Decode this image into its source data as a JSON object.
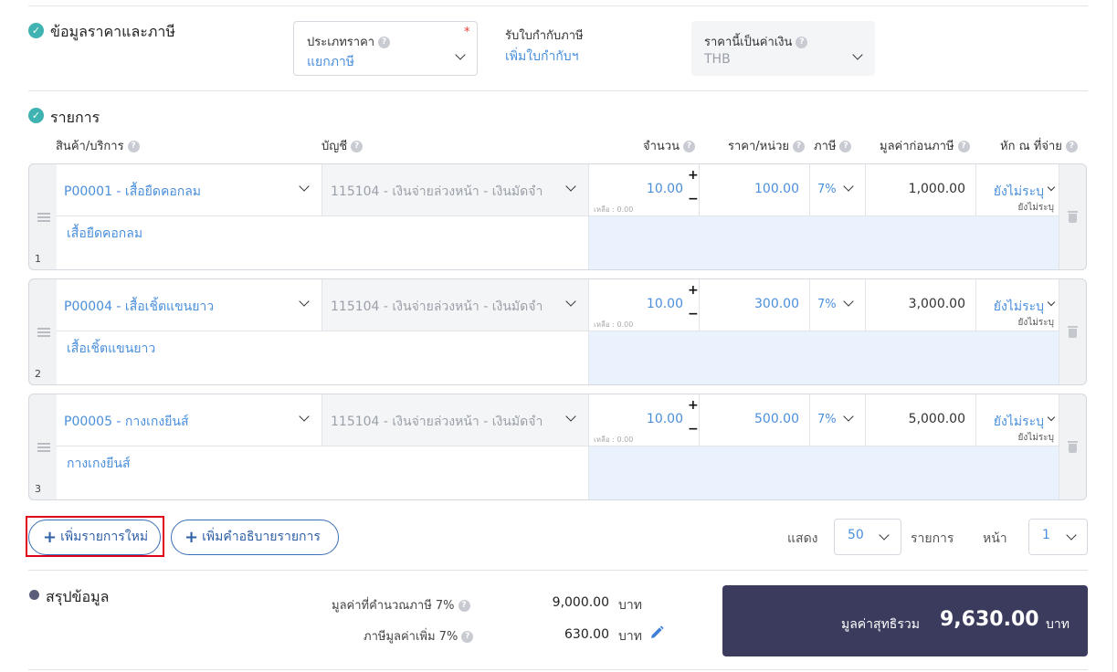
{
  "price_tax": {
    "title": "ข้อมูลราคาและภาษี",
    "price_type_label": "ประเภทราคา",
    "price_type_value": "แยกภาษี",
    "tax_invoice_label": "รับใบกำกับภาษี",
    "tax_invoice_link": "เพิ่มใบกำกับฯ",
    "currency_label": "ราคานี้เป็นค่าเงิน",
    "currency_value": "THB"
  },
  "items": {
    "title": "รายการ",
    "headers": {
      "product": "สินค้า/บริการ",
      "account": "บัญชี",
      "quantity": "จำนวน",
      "unit_price": "ราคา/หน่วย",
      "tax": "ภาษี",
      "pretax": "มูลค่าก่อนภาษี",
      "withholding": "หัก ณ ที่จ่าย"
    },
    "rows": [
      {
        "index": "1",
        "product": "P00001 - เสื้อยืดคอกลม",
        "account": "115104 - เงินจ่ายล่วงหน้า - เงินมัดจำ",
        "quantity": "10.00",
        "remaining": "เหลือ : 0.00",
        "price": "100.00",
        "tax": "7%",
        "pretax": "1,000.00",
        "withholding": "ยังไม่ระบุ",
        "withholding_sub": "ยังไม่ระบุ",
        "description": "เสื้อยืดคอกลม"
      },
      {
        "index": "2",
        "product": "P00004 - เสื้อเชิ้ตแขนยาว",
        "account": "115104 - เงินจ่ายล่วงหน้า - เงินมัดจำ",
        "quantity": "10.00",
        "remaining": "เหลือ : 0.00",
        "price": "300.00",
        "tax": "7%",
        "pretax": "3,000.00",
        "withholding": "ยังไม่ระบุ",
        "withholding_sub": "ยังไม่ระบุ",
        "description": "เสื้อเชิ้ตแขนยาว"
      },
      {
        "index": "3",
        "product": "P00005 - กางเกงยีนส์",
        "account": "115104 - เงินจ่ายล่วงหน้า - เงินมัดจำ",
        "quantity": "10.00",
        "remaining": "เหลือ : 0.00",
        "price": "500.00",
        "tax": "7%",
        "pretax": "5,000.00",
        "withholding": "ยังไม่ระบุ",
        "withholding_sub": "ยังไม่ระบุ",
        "description": "กางเกงยีนส์"
      }
    ],
    "add_item_button": "เพิ่มรายการใหม่",
    "add_desc_button": "เพิ่มคำอธิบายรายการ",
    "pagination": {
      "show_label": "แสดง",
      "per_page": "50",
      "items_label": "รายการ",
      "page_label": "หน้า",
      "page": "1"
    }
  },
  "summary": {
    "title": "สรุปข้อมูล",
    "taxable_label": "มูลค่าที่คำนวณภาษี 7%",
    "taxable_value": "9,000.00",
    "vat_label": "ภาษีมูลค่าเพิ่ม 7%",
    "vat_value": "630.00",
    "currency_unit": "บาท",
    "grand_total_label": "มูลค่าสุทธิรวม",
    "grand_total_value": "9,630.00"
  },
  "colors": {
    "accent": "#4a8fdc",
    "check": "#3fb3b1",
    "total_bg": "#3b3c5d",
    "highlight": "#e0001a"
  }
}
